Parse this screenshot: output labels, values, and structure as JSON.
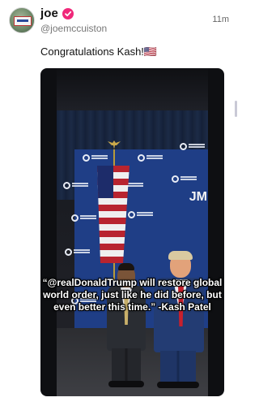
{
  "post": {
    "author": {
      "display_name": "joe",
      "handle": "@joemccuiston",
      "verified": true,
      "verified_color": "#f0287a"
    },
    "timestamp": "11m",
    "text": "Congratulations Kash!🇺🇸",
    "media": {
      "caption_lines": [
        "“@realDonaldTrump will restore global",
        "world order, just like he did before, but",
        "even better this time.” -Kash Patel"
      ],
      "watermark": "JM"
    }
  }
}
